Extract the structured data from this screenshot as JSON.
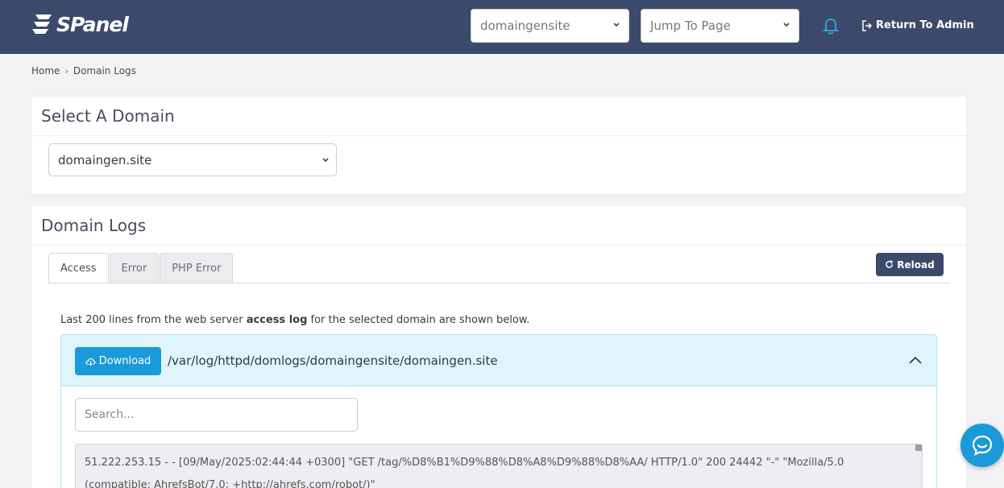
{
  "header": {
    "logo_text": "SPanel",
    "account_select": "domaingensite",
    "jump_select": "Jump To Page",
    "return_admin": "Return To Admin"
  },
  "breadcrumb": {
    "home": "Home",
    "current": "Domain Logs"
  },
  "select_domain": {
    "title": "Select A Domain",
    "value": "domaingen.site"
  },
  "domain_logs": {
    "title": "Domain Logs",
    "tabs": [
      {
        "label": "Access",
        "active": true
      },
      {
        "label": "Error",
        "active": false
      },
      {
        "label": "PHP Error",
        "active": false
      }
    ],
    "reload_label": "Reload",
    "info_prefix": "Last 200 lines from the web server",
    "info_bold": "access log",
    "info_suffix": "for the selected domain are shown below.",
    "download_label": "Download",
    "log_path": "/var/log/httpd/domlogs/domaingensite/domaingen.site",
    "search_placeholder": "Search...",
    "log_line": "51.222.253.15 - - [09/May/2025:02:44:44 +0300] \"GET /tag/%D8%B1%D9%88%D8%A8%D9%88%D8%AA/ HTTP/1.0\" 200 24442 \"-\" \"Mozilla/5.0 (compatible; AhrefsBot/7.0; +http://ahrefs.com/robot/)\""
  },
  "colors": {
    "topbar": "#3b4a6b",
    "accent": "#1b9ad9",
    "reload": "#3b4a6b"
  }
}
